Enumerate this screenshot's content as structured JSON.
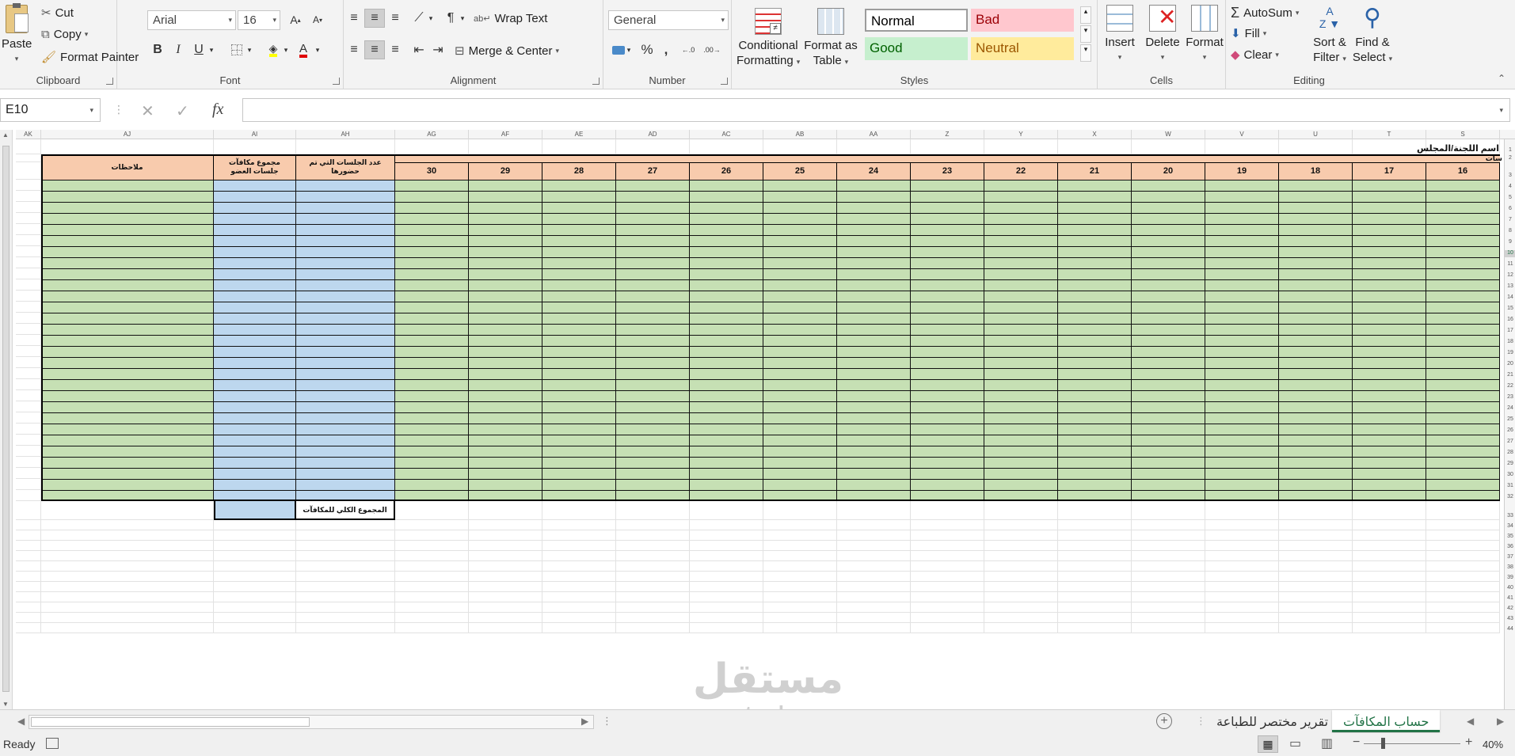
{
  "ribbon": {
    "clipboard": {
      "label": "Clipboard",
      "paste": "Paste",
      "cut": "Cut",
      "copy": "Copy",
      "format_painter": "Format Painter"
    },
    "font": {
      "label": "Font",
      "family": "Arial",
      "size": "16",
      "bold": "B",
      "italic": "I",
      "underline": "U"
    },
    "alignment": {
      "label": "Alignment",
      "wrap_text": "Wrap Text",
      "merge_center": "Merge & Center"
    },
    "number": {
      "label": "Number",
      "format": "General",
      "percent": "%",
      "comma": ","
    },
    "styles": {
      "label": "Styles",
      "conditional_formatting_1": "Conditional",
      "conditional_formatting_2": "Formatting",
      "format_as_table_1": "Format as",
      "format_as_table_2": "Table",
      "normal": "Normal",
      "bad": "Bad",
      "good": "Good",
      "neutral": "Neutral"
    },
    "cells": {
      "label": "Cells",
      "insert": "Insert",
      "delete": "Delete",
      "format": "Format"
    },
    "editing": {
      "label": "Editing",
      "autosum": "AutoSum",
      "fill": "Fill",
      "clear": "Clear",
      "sort_filter_1": "Sort &",
      "sort_filter_2": "Filter",
      "find_select_1": "Find &",
      "find_select_2": "Select"
    }
  },
  "formula_bar": {
    "name_box": "E10",
    "fx": "fx",
    "formula": ""
  },
  "columns": [
    "AK",
    "AJ",
    "AI",
    "AH",
    "AG",
    "AF",
    "AE",
    "AD",
    "AC",
    "AB",
    "AA",
    "Z",
    "Y",
    "X",
    "W",
    "V",
    "U",
    "T",
    "S"
  ],
  "sheet": {
    "title": "اسم اللجنة/المجلس",
    "sessions_header_fragment": "سات",
    "notes_header": "ملاحظات",
    "total_member_rewards_header": "مجموع مكافآت جلسات العضو",
    "sessions_attended_header": "عدد الجلسات التي تم حضورها",
    "grand_total_label": "المجموع الكلي للمكافآت",
    "session_numbers": [
      "30",
      "29",
      "28",
      "27",
      "26",
      "25",
      "24",
      "23",
      "22",
      "21",
      "20",
      "19",
      "18",
      "17",
      "16"
    ],
    "row_numbers": [
      "1",
      "2",
      "3",
      "4",
      "5",
      "6",
      "7",
      "8",
      "9",
      "10",
      "11",
      "12",
      "13",
      "14",
      "15",
      "16",
      "17",
      "18",
      "19",
      "20",
      "21",
      "22",
      "23",
      "24",
      "25",
      "26",
      "27",
      "28",
      "29",
      "30",
      "31",
      "32",
      "33",
      "34",
      "35",
      "36",
      "37",
      "38",
      "39",
      "40",
      "41",
      "42",
      "43",
      "44"
    ]
  },
  "sheet_tabs": {
    "tab1": "حساب المكافآت",
    "tab2": "تقرير مختصر للطباعة"
  },
  "status": {
    "ready": "Ready",
    "zoom": "40%"
  },
  "watermark": {
    "ar": "مستقل",
    "en": "mostaql.com"
  },
  "colors": {
    "orange_header": "#f8cbad",
    "green_body": "#c6e0b4",
    "blue_body": "#bdd7ee",
    "excel_green": "#217346"
  }
}
